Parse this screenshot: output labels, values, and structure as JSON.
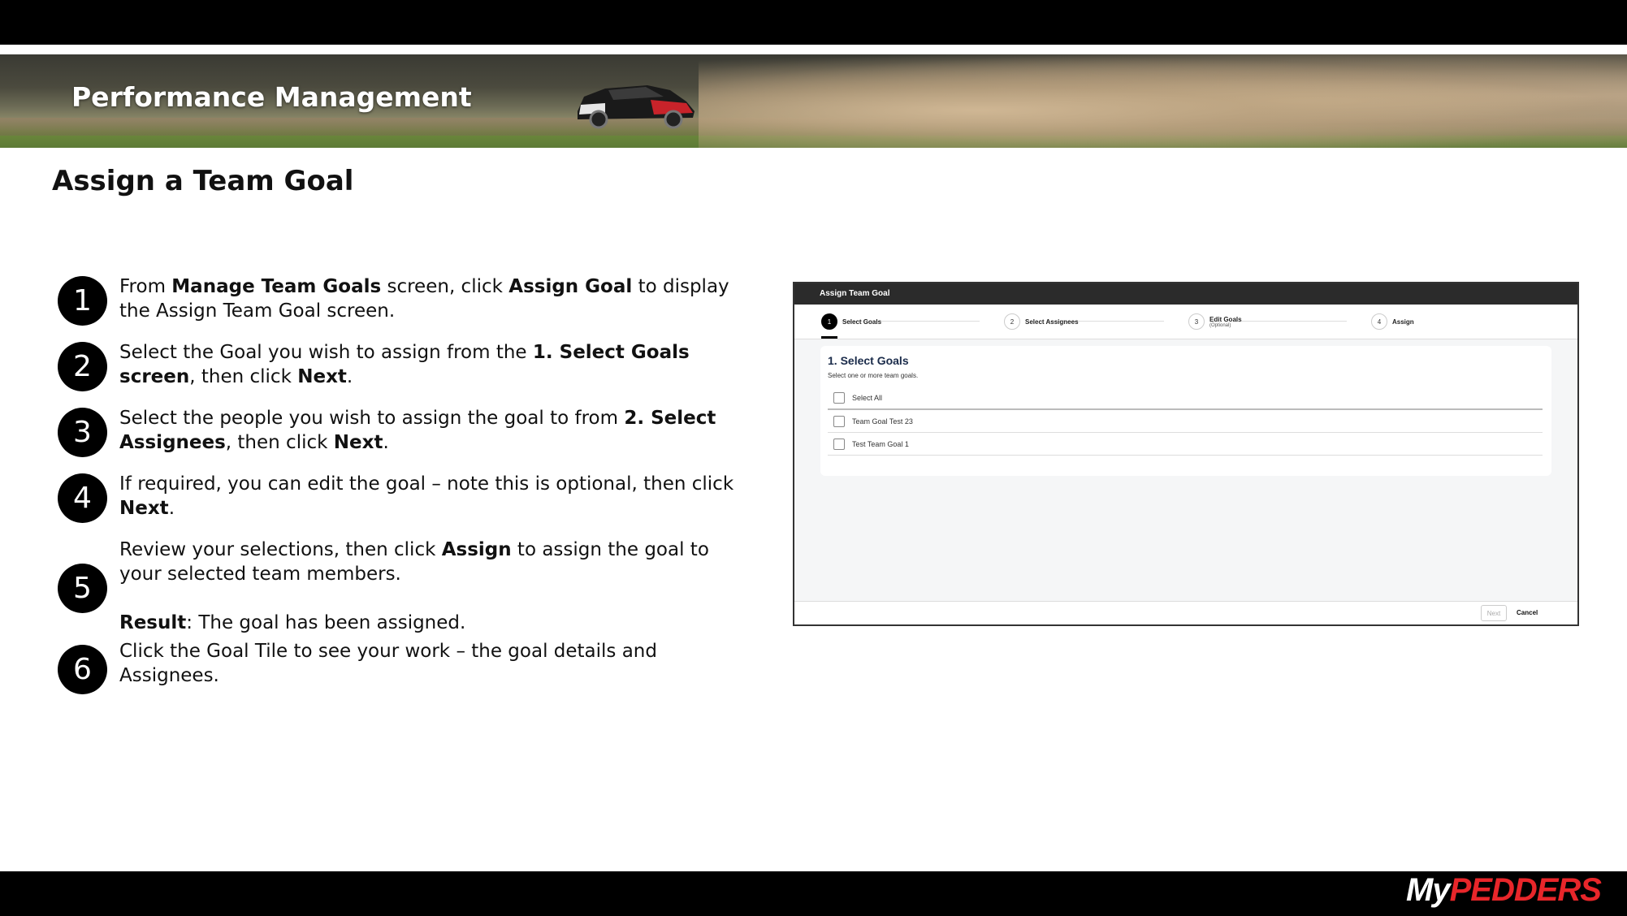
{
  "banner": {
    "title": "Performance Management"
  },
  "page": {
    "title": "Assign a Team Goal"
  },
  "steps": [
    {
      "num": "1",
      "parts": [
        {
          "t": "From ",
          "b": false
        },
        {
          "t": "Manage Team Goals",
          "b": true
        },
        {
          "t": " screen, click ",
          "b": false
        },
        {
          "t": "Assign Goal",
          "b": true
        },
        {
          "t": " to display the Assign Team Goal screen.",
          "b": false
        }
      ]
    },
    {
      "num": "2",
      "parts": [
        {
          "t": "Select the Goal you wish to assign from the ",
          "b": false
        },
        {
          "t": "1. Select Goals screen",
          "b": true
        },
        {
          "t": ", then click ",
          "b": false
        },
        {
          "t": "Next",
          "b": true
        },
        {
          "t": ".",
          "b": false
        }
      ]
    },
    {
      "num": "3",
      "parts": [
        {
          "t": "Select the people you wish to assign the goal to from ",
          "b": false
        },
        {
          "t": "2. Select Assignees",
          "b": true
        },
        {
          "t": ", then click ",
          "b": false
        },
        {
          "t": "Next",
          "b": true
        },
        {
          "t": ".",
          "b": false
        }
      ]
    },
    {
      "num": "4",
      "parts": [
        {
          "t": "If required, you can edit the goal – note this is optional, then click ",
          "b": false
        },
        {
          "t": "Next",
          "b": true
        },
        {
          "t": ".",
          "b": false
        }
      ]
    },
    {
      "num": "5",
      "parts": [
        {
          "t": "Review your selections, then click ",
          "b": false
        },
        {
          "t": "Assign",
          "b": true
        },
        {
          "t": " to assign the goal to your selected team members.",
          "b": false
        }
      ],
      "result_label": "Result",
      "result_text": ": The goal has been assigned."
    },
    {
      "num": "6",
      "parts": [
        {
          "t": "Click the Goal Tile to see your work – the goal details and Assignees.",
          "b": false
        }
      ]
    }
  ],
  "app": {
    "header": "Assign Team Goal",
    "wizard": [
      {
        "num": "1",
        "label": "Select Goals",
        "sub": ""
      },
      {
        "num": "2",
        "label": "Select Assignees",
        "sub": ""
      },
      {
        "num": "3",
        "label": "Edit Goals",
        "sub": "(Optional)"
      },
      {
        "num": "4",
        "label": "Assign",
        "sub": ""
      }
    ],
    "card_title": "1. Select Goals",
    "card_sub": "Select one or more team goals.",
    "select_all": "Select All",
    "goals": [
      "Team Goal Test 23",
      "Test Team Goal 1"
    ],
    "next": "Next",
    "cancel": "Cancel"
  },
  "logo": {
    "my": "My",
    "brand": "PEDDERS"
  },
  "colors": {
    "brand_red": "#e8262a",
    "dark": "#000000"
  }
}
